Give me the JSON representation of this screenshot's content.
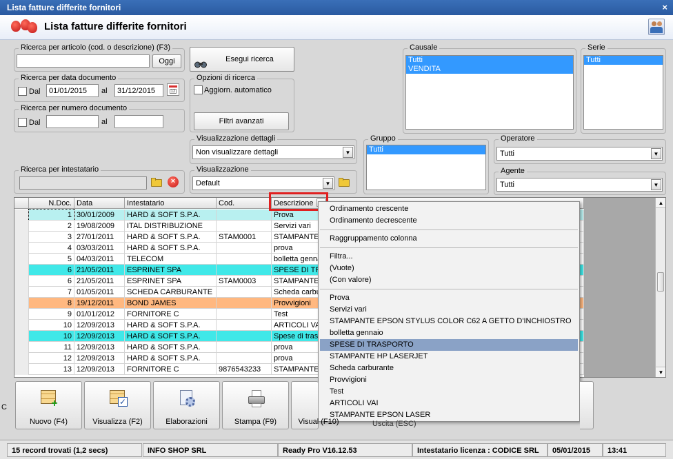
{
  "window": {
    "title": "Lista fatture differite fornitori",
    "close": "×"
  },
  "header": {
    "title": "Lista fatture differite fornitori"
  },
  "search_article": {
    "legend": "Ricerca per articolo (cod. o descrizione) (F3)",
    "value": "",
    "today_button": "Oggi"
  },
  "search_button": "Esegui ricerca",
  "search_date": {
    "legend": "Ricerca per data documento",
    "dal_label": "Dal",
    "from": "01/01/2015",
    "al_label": "al",
    "to": "31/12/2015"
  },
  "search_options": {
    "legend": "Opzioni di ricerca",
    "auto_update": "Aggiorn. automatico",
    "advanced_filters": "Filtri avanzati"
  },
  "search_number": {
    "legend": "Ricerca per numero documento",
    "dal_label": "Dal",
    "from": "",
    "al_label": "al",
    "to": ""
  },
  "causale": {
    "legend": "Causale",
    "items": [
      "Tutti",
      "VENDITA"
    ]
  },
  "serie": {
    "legend": "Serie",
    "items": [
      "Tutti"
    ]
  },
  "details_view": {
    "legend": "Visualizzazione dettagli",
    "value": "Non visualizzare dettagli"
  },
  "gruppo": {
    "legend": "Gruppo",
    "items": [
      "Tutti"
    ]
  },
  "operatore": {
    "legend": "Operatore",
    "value": "Tutti"
  },
  "intestatario": {
    "legend": "Ricerca per intestatario",
    "value": ""
  },
  "view": {
    "legend": "Visualizzazione",
    "value": "Default"
  },
  "agente": {
    "legend": "Agente",
    "value": "Tutti"
  },
  "grid": {
    "columns": [
      "N.Doc.",
      "Data",
      "Intestatario",
      "Cod.",
      "Descrizione"
    ],
    "rows": [
      {
        "n": "1",
        "data": "30/01/2009",
        "intestatario": "HARD & SOFT S.P.A.",
        "cod": "",
        "descr": "Prova",
        "color": "#b8f0f0"
      },
      {
        "n": "2",
        "data": "19/08/2009",
        "intestatario": "ITAL DISTRIBUZIONE",
        "cod": "",
        "descr": "Servizi vari",
        "color": "#ffffff"
      },
      {
        "n": "3",
        "data": "27/01/2011",
        "intestatario": "HARD & SOFT S.P.A.",
        "cod": "STAM0001",
        "descr": "STAMPANTE",
        "color": "#ffffff"
      },
      {
        "n": "4",
        "data": "03/03/2011",
        "intestatario": "HARD & SOFT S.P.A.",
        "cod": "",
        "descr": "prova",
        "color": "#ffffff"
      },
      {
        "n": "5",
        "data": "04/03/2011",
        "intestatario": "TELECOM",
        "cod": "",
        "descr": "bolletta genna",
        "color": "#ffffff"
      },
      {
        "n": "6",
        "data": "21/05/2011",
        "intestatario": "ESPRINET SPA",
        "cod": "",
        "descr": "SPESE DI TRA",
        "color": "#40e8e8"
      },
      {
        "n": "6",
        "data": "21/05/2011",
        "intestatario": "ESPRINET SPA",
        "cod": "STAM0003",
        "descr": "STAMPANTE",
        "color": "#ffffff"
      },
      {
        "n": "7",
        "data": "01/05/2011",
        "intestatario": "SCHEDA CARBURANTE",
        "cod": "",
        "descr": "Scheda carbur",
        "color": "#ffffff"
      },
      {
        "n": "8",
        "data": "19/12/2011",
        "intestatario": "BOND JAMES",
        "cod": "",
        "descr": "Provvigioni",
        "color": "#ffb880"
      },
      {
        "n": "9",
        "data": "01/01/2012",
        "intestatario": "FORNITORE C",
        "cod": "",
        "descr": "Test",
        "color": "#ffffff"
      },
      {
        "n": "10",
        "data": "12/09/2013",
        "intestatario": "HARD & SOFT S.P.A.",
        "cod": "",
        "descr": "ARTICOLI VAI",
        "color": "#ffffff"
      },
      {
        "n": "10",
        "data": "12/09/2013",
        "intestatario": "HARD & SOFT S.P.A.",
        "cod": "",
        "descr": "Spese di tras",
        "color": "#40e8e8"
      },
      {
        "n": "11",
        "data": "12/09/2013",
        "intestatario": "HARD & SOFT S.P.A.",
        "cod": "",
        "descr": "prova",
        "color": "#ffffff"
      },
      {
        "n": "12",
        "data": "12/09/2013",
        "intestatario": "HARD & SOFT S.P.A.",
        "cod": "",
        "descr": "prova",
        "color": "#ffffff"
      },
      {
        "n": "13",
        "data": "12/09/2013",
        "intestatario": "FORNITORE C",
        "cod": "9876543233",
        "descr": "STAMPANTE",
        "color": "#ffffff"
      }
    ]
  },
  "context_menu": {
    "sort_asc": "Ordinamento crescente",
    "sort_desc": "Ordinamento decrescente",
    "group": "Raggruppamento colonna",
    "filter": "Filtra...",
    "empty": "(Vuote)",
    "with_value": "(Con valore)",
    "values": [
      "Prova",
      "Servizi vari",
      "STAMPANTE EPSON STYLUS COLOR C62 A GETTO D'INCHIOSTRO",
      "bolletta gennaio",
      "SPESE DI TRASPORTO",
      "STAMPANTE HP LASERJET",
      "Scheda carburante",
      "Provvigioni",
      "Test",
      "ARTICOLI VAI",
      "STAMPANTE EPSON LASER"
    ],
    "highlighted": "SPESE DI TRASPORTO"
  },
  "toolbar": {
    "new": "Nuovo (F4)",
    "view": "Visualizza (F2)",
    "process": "Elaborazioni",
    "print": "Stampa (F9)",
    "visual": "Visual (F10)",
    "exit": "Uscita (ESC)",
    "edge_text": "C"
  },
  "status": {
    "records": "15 record trovati (1,2 secs)",
    "company": "INFO SHOP SRL",
    "version": "Ready Pro V16.12.53",
    "license": "Intestatario licenza : CODICE SRL",
    "date": "05/01/2015",
    "time": "13:41"
  }
}
